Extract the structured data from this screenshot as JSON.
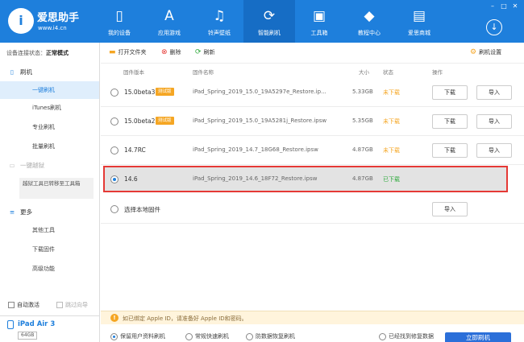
{
  "app": {
    "name": "爱思助手",
    "url": "www.i4.cn"
  },
  "nav": [
    {
      "label": "我的设备",
      "icon": "phone-icon"
    },
    {
      "label": "应用游戏",
      "icon": "app-store-icon"
    },
    {
      "label": "铃声壁纸",
      "icon": "music-icon"
    },
    {
      "label": "智能刷机",
      "icon": "refresh-icon"
    },
    {
      "label": "工具箱",
      "icon": "toolbox-icon"
    },
    {
      "label": "教程中心",
      "icon": "graduation-cap-icon"
    },
    {
      "label": "爱思商城",
      "icon": "shop-icon"
    }
  ],
  "window_controls": [
    "minimize",
    "maximize",
    "close"
  ],
  "sidebar": {
    "status_label": "设备连接状态：",
    "status_value": "正常模式",
    "group_flash": "刷机",
    "items_flash": [
      "一键刷机",
      "iTunes刷机",
      "专业刷机",
      "批量刷机"
    ],
    "jailbreak": "一键越狱",
    "jailbreak_notice": "越狱工具已转移至工具箱",
    "group_more": "更多",
    "items_more": [
      "其他工具",
      "下载固件",
      "高级功能"
    ],
    "auto_activate": "自动激活",
    "skip_guide": "跳过向导",
    "device_name": "iPad Air 3",
    "device_capacity": "64GB"
  },
  "toolbar": {
    "open_folder": "打开文件夹",
    "delete": "删除",
    "refresh": "刷新",
    "settings": "刷机设置"
  },
  "table": {
    "headers": {
      "version": "固件版本",
      "name": "固件名称",
      "size": "大小",
      "status": "状态",
      "action": "操作"
    },
    "rows": [
      {
        "version": "15.0beta3",
        "badge": "测试版",
        "name": "iPad_Spring_2019_15.0_19A5297e_Restore.ip...",
        "size": "5.33GB",
        "status": "未下载",
        "download": "下载",
        "import": "导入"
      },
      {
        "version": "15.0beta2",
        "badge": "测试版",
        "name": "iPad_Spring_2019_15.0_19A5281j_Restore.ipsw",
        "size": "5.35GB",
        "status": "未下载",
        "download": "下载",
        "import": "导入"
      },
      {
        "version": "14.7RC",
        "badge": "",
        "name": "iPad_Spring_2019_14.7_18G68_Restore.ipsw",
        "size": "4.87GB",
        "status": "未下载",
        "download": "下载",
        "import": "导入"
      },
      {
        "version": "14.6",
        "badge": "",
        "name": "iPad_Spring_2019_14.6_18F72_Restore.ipsw",
        "size": "4.87GB",
        "status": "已下载",
        "download": "",
        "import": ""
      }
    ],
    "local_option": "选择本地固件",
    "local_import": "导入"
  },
  "notice": {
    "text": "如已绑定 Apple ID，请准备好 Apple ID和密码。"
  },
  "options": {
    "keep_data": "保留用户资料刷机",
    "quick": "常规快速刷机",
    "anti_recovery": "防数据恢复刷机",
    "anti_recovery_link": "",
    "only_repair": "已经找到修复数据",
    "flash_now": "立即刷机"
  },
  "colors": {
    "primary": "#1e7fdc",
    "not_downloaded": "#f5a623",
    "downloaded": "#2eaa3c",
    "highlight_border": "#e53935"
  }
}
